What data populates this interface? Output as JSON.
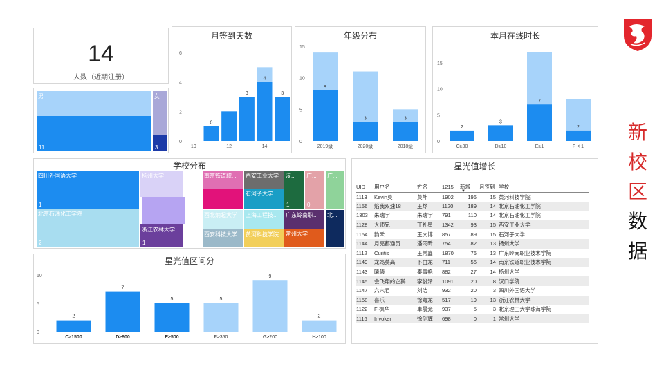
{
  "side_title": [
    "新",
    "校",
    "区",
    "数",
    "据"
  ],
  "logo": {
    "name": "dragon-shield-logo",
    "color": "#e3262d"
  },
  "kpi": {
    "value": "14",
    "label": "人数（近期注册）"
  },
  "gender": {
    "items": [
      {
        "label": "男",
        "value": 11
      },
      {
        "label": "女",
        "value": 3
      }
    ]
  },
  "colors": {
    "light": "#a7d3fa",
    "dark": "#1c8cf0",
    "accent_red": "#d72b2b"
  },
  "charts": {
    "signin": {
      "chart_data": {
        "type": "bar",
        "title": "月签到天数",
        "x": [
          10,
          11,
          12,
          13,
          14,
          15
        ],
        "xticks": [
          10,
          12,
          14
        ],
        "series": [
          {
            "values": [
              0,
              1,
              2,
              3,
              4,
              3
            ]
          },
          {
            "values": [
              0,
              0,
              0,
              3,
              5,
              3
            ]
          }
        ],
        "labels": [
          "",
          "0",
          "",
          "3",
          "4",
          "3"
        ],
        "ylim": [
          0,
          6
        ],
        "yticks": [
          0,
          2,
          4,
          6
        ]
      }
    },
    "grade": {
      "chart_data": {
        "type": "bar",
        "title": "年级分布",
        "categories": [
          "2019级",
          "2020级",
          "2018级"
        ],
        "series": [
          {
            "values": [
              8,
              3,
              3
            ]
          },
          {
            "values": [
              14,
              11,
              5
            ]
          }
        ],
        "labels": [
          "8",
          "3",
          "3"
        ],
        "ylim": [
          0,
          15
        ],
        "yticks": [
          0,
          5,
          10,
          15
        ]
      }
    },
    "online": {
      "chart_data": {
        "type": "bar",
        "title": "本月在线时长",
        "categories": [
          "C≥30",
          "D≥10",
          "E≥1",
          "F < 1"
        ],
        "series": [
          {
            "values": [
              2,
              3,
              7,
              2
            ]
          },
          {
            "values": [
              2,
              3,
              17,
              8
            ]
          }
        ],
        "labels": [
          "2",
          "3",
          "7",
          "2"
        ],
        "ylim": [
          0,
          15
        ],
        "yticks": [
          0,
          5,
          10,
          15
        ]
      }
    },
    "star": {
      "chart_data": {
        "type": "bar",
        "title": "星光值区间分",
        "categories": [
          "C≥1500",
          "D≥800",
          "E≥500",
          "F≥350",
          "G≥200",
          "H≥100"
        ],
        "values": [
          2,
          7,
          5,
          5,
          9,
          2
        ],
        "dark_count": 3,
        "labels": [
          "2",
          "7",
          "5",
          "5",
          "9",
          "2"
        ],
        "ylim": [
          0,
          10
        ],
        "yticks": [
          0,
          5,
          10
        ]
      }
    }
  },
  "school_dist": {
    "title": "学校分布",
    "tiles": [
      {
        "label": "四川外国语大学",
        "value": "1",
        "color": "#1c8cf0"
      },
      {
        "label": "北京石油化工学院",
        "value": "2",
        "color": "#a8ddf0"
      },
      {
        "label": "扬州大学",
        "value": "",
        "color": "#d9d2f7"
      },
      {
        "label": "",
        "value": "",
        "color": "#b6a4f2"
      },
      {
        "label": "浙江农林大学",
        "value": "1",
        "color": "#6b3f9c"
      },
      {
        "label": "南京铁道职...",
        "value": "",
        "color": "#e06fb3"
      },
      {
        "label": "",
        "value": "",
        "color": "#e2127a"
      },
      {
        "label": "西安工业大学",
        "value": "",
        "color": "#6d6d6d"
      },
      {
        "label": "石河子大学",
        "value": "",
        "color": "#1a9ec6"
      },
      {
        "label": "西北纳起大学",
        "value": "",
        "color": "#c9eef4"
      },
      {
        "label": "上海工程技...",
        "value": "",
        "color": "#a8e8ef"
      },
      {
        "label": "西安科技大学",
        "value": "",
        "color": "#9bb9c9"
      },
      {
        "label": "黄河科技学院",
        "value": "",
        "color": "#f2cf5a"
      },
      {
        "label": "汉...",
        "value": "1",
        "color": "#1d6b3f"
      },
      {
        "label": "广...",
        "value": "0",
        "color": "#e3a2a8"
      },
      {
        "label": "广...",
        "value": "",
        "color": "#8fd39a"
      },
      {
        "label": "广东岭南职...",
        "value": "",
        "color": "#5a2f6e"
      },
      {
        "label": "北...",
        "value": "",
        "color": "#0e2a5e"
      },
      {
        "label": "常州大学",
        "value": "",
        "color": "#e05b1c"
      }
    ]
  },
  "leaderboard": {
    "title": "星光值增长",
    "columns": [
      "UID",
      "用户名",
      "姓名",
      "1215",
      "新增",
      "月签到",
      "学校"
    ],
    "rows": [
      [
        "1113",
        "Kevin莫",
        "莫坤",
        "1902",
        "196",
        "15",
        "黄河科技学院"
      ],
      [
        "1156",
        "焰我双速18",
        "王烨",
        "1120",
        "189",
        "14",
        "北京石油化工学院"
      ],
      [
        "1303",
        "朱瑞宇",
        "朱瑞宇",
        "791",
        "110",
        "14",
        "北京石油化工学院"
      ],
      [
        "1128",
        "大师兄",
        "丁礼星",
        "1342",
        "93",
        "15",
        "西安工业大学"
      ],
      [
        "1154",
        "韵禾",
        "王文博",
        "857",
        "89",
        "15",
        "石河子大学"
      ],
      [
        "1144",
        "月亮都通员",
        "潘雨昕",
        "754",
        "82",
        "13",
        "扬州大学"
      ],
      [
        "1112",
        "Curitis",
        "王常鑫",
        "1870",
        "76",
        "13",
        "广东岭南职业技术学院"
      ],
      [
        "1149",
        "龙殇莫离",
        "卜白龙",
        "711",
        "56",
        "14",
        "南京铁道职业技术学院"
      ],
      [
        "1143",
        "曦曦",
        "秦雪艳",
        "882",
        "27",
        "14",
        "扬州大学"
      ],
      [
        "1145",
        "会飞翔的企鹅",
        "李俊泽",
        "1091",
        "20",
        "8",
        "汉口学院"
      ],
      [
        "1147",
        "六六君",
        "刘洁",
        "932",
        "20",
        "3",
        "四川外国语大学"
      ],
      [
        "1158",
        "喜乐",
        "徐粤龙",
        "517",
        "19",
        "13",
        "浙江农林大学"
      ],
      [
        "1122",
        "F-枫华",
        "車晨光",
        "937",
        "5",
        "3",
        "北京理工大学珠海学院"
      ],
      [
        "1116",
        "Invoker",
        "徐剑辉",
        "698",
        "0",
        "1",
        "常州大学"
      ]
    ]
  }
}
